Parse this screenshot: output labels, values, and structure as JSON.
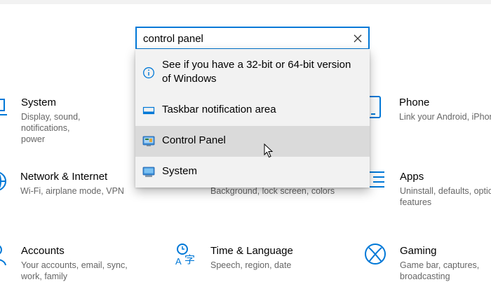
{
  "search": {
    "value": "control panel",
    "clear_icon": "close-icon"
  },
  "suggestions": [
    {
      "label_line1": "See if you have a 32-bit or 64-bit version",
      "label_line2": "of Windows",
      "icon": "info-icon"
    },
    {
      "label": "Taskbar notification area",
      "icon": "taskbar-icon"
    },
    {
      "label": "Control Panel",
      "icon": "control-panel-icon",
      "hovered": true
    },
    {
      "label": "System",
      "icon": "system-icon"
    }
  ],
  "tiles": {
    "system": {
      "title": "System",
      "desc_line1": "Display, sound, notifications,",
      "desc_line2": "power",
      "icon": "laptop-icon"
    },
    "phone": {
      "title": "Phone",
      "desc_line1": "Link your Android, iPhone",
      "icon": "phone-icon"
    },
    "network": {
      "title": "Network & Internet",
      "desc_line1": "Wi-Fi, airplane mode, VPN",
      "icon": "globe-icon"
    },
    "personalization": {
      "desc_line1": "Background, lock screen, colors"
    },
    "apps": {
      "title": "Apps",
      "desc_line1": "Uninstall, defaults, optional",
      "desc_line2": "features",
      "icon": "apps-list-icon"
    },
    "accounts": {
      "title": "Accounts",
      "desc_line1": "Your accounts, email, sync,",
      "desc_line2": "work, family",
      "icon": "person-icon"
    },
    "time": {
      "title": "Time & Language",
      "desc_line1": "Speech, region, date",
      "icon": "time-language-icon"
    },
    "gaming": {
      "title": "Gaming",
      "desc_line1": "Game bar, captures,",
      "desc_line2": "broadcasting",
      "icon": "xbox-icon"
    }
  },
  "colors": {
    "accent": "#0078d7",
    "dropdown_bg": "#f2f2f2",
    "hover_bg": "#dadada",
    "desc_text": "#666666"
  }
}
